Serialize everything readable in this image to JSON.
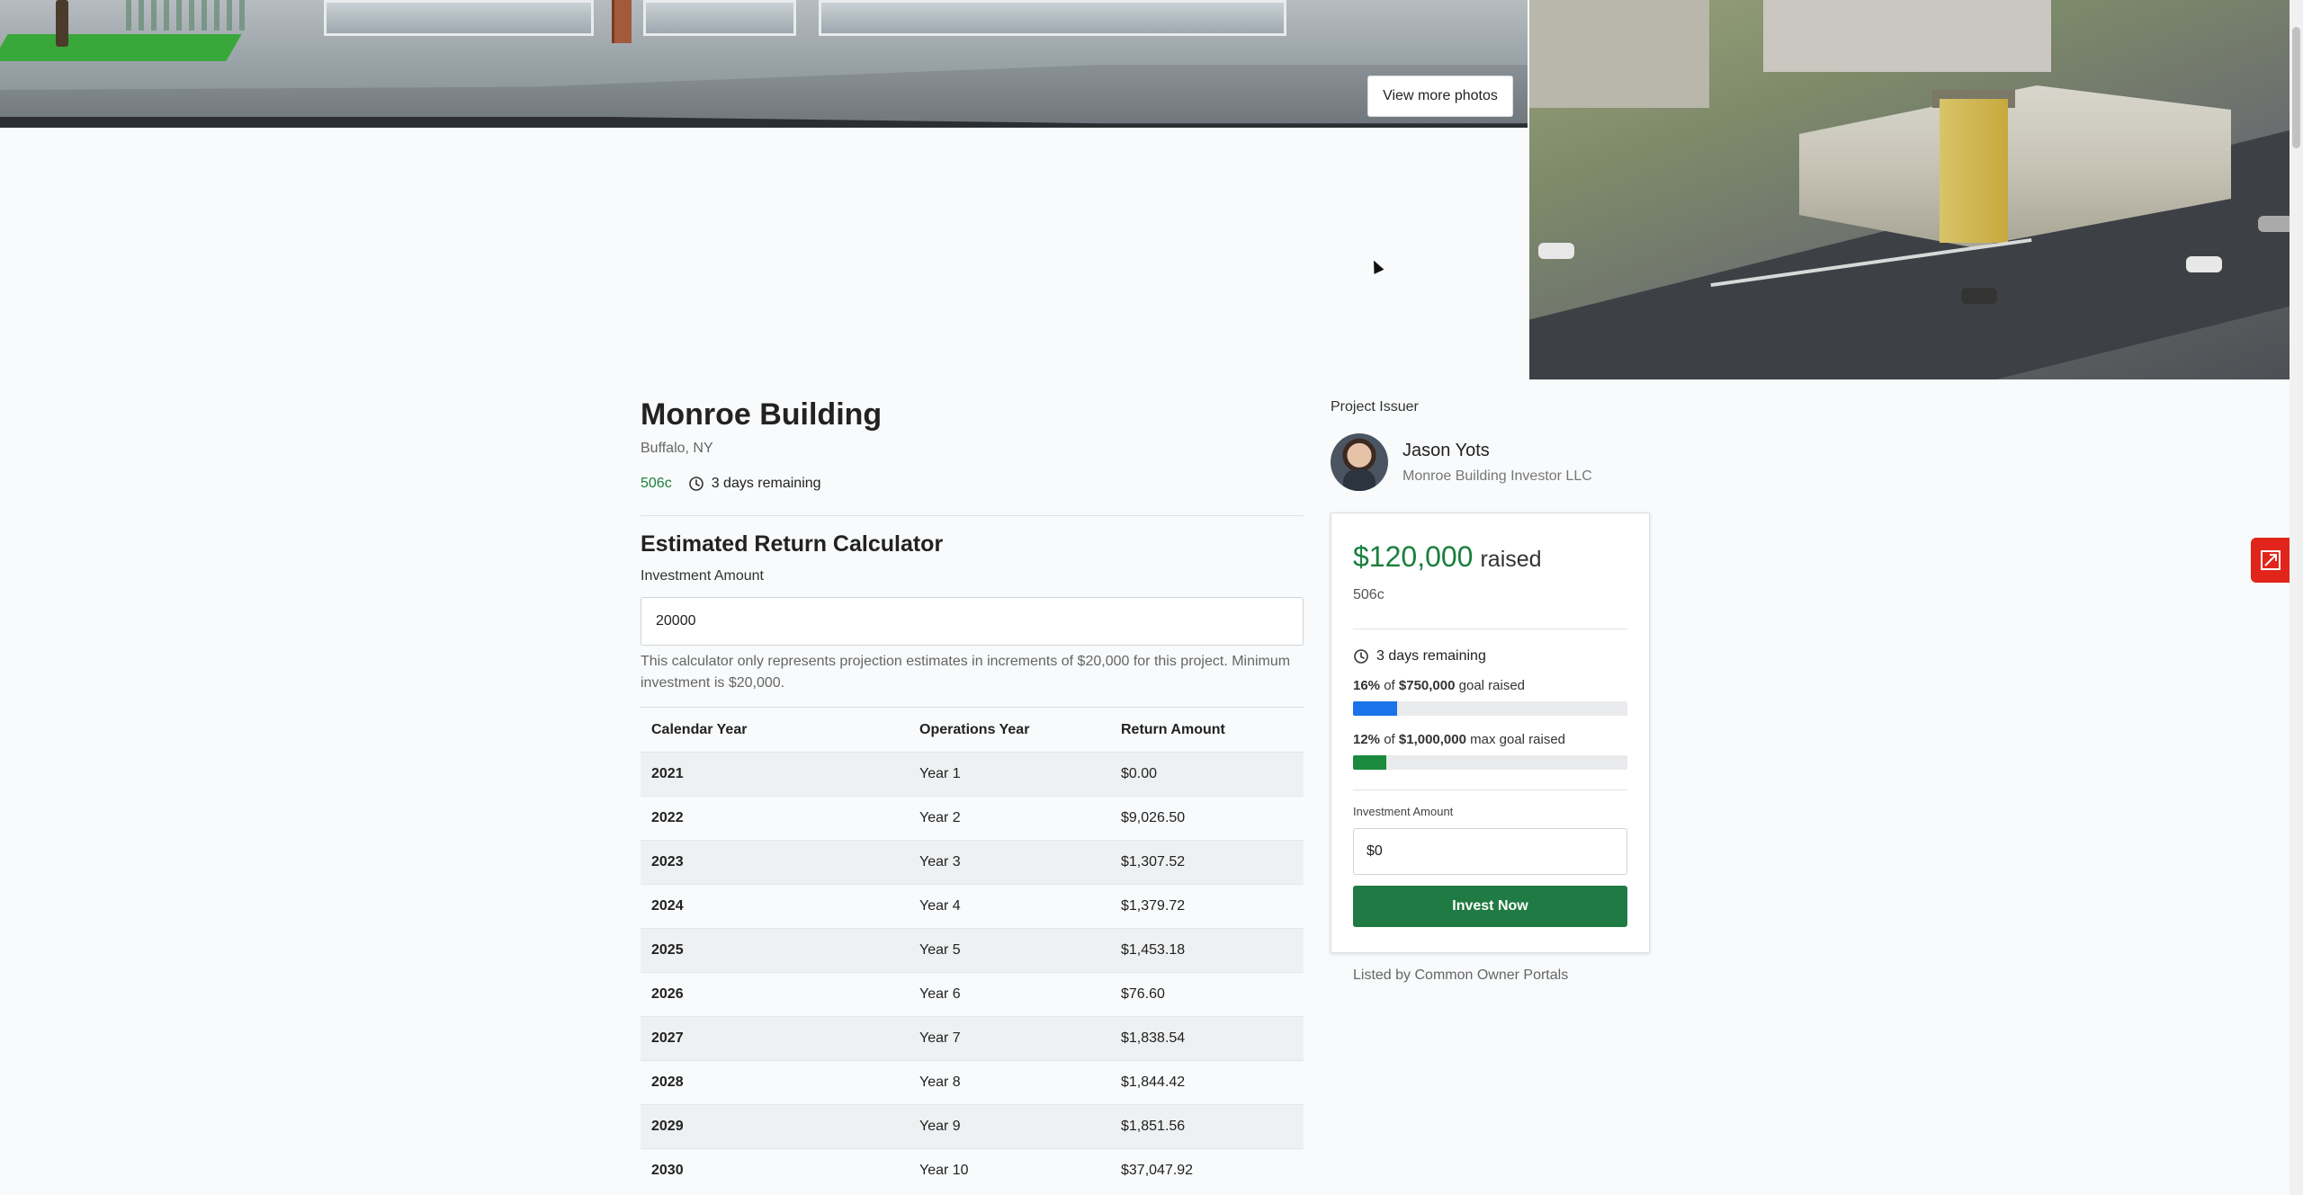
{
  "hero": {
    "view_photos_label": "View more photos"
  },
  "project": {
    "title": "Monroe Building",
    "location": "Buffalo, NY",
    "offering_type": "506c",
    "time_remaining": "3 days remaining"
  },
  "calculator": {
    "title": "Estimated Return Calculator",
    "amount_label": "Investment Amount",
    "amount_value": "20000",
    "note": "This calculator only represents projection estimates in increments of $20,000 for this project. Minimum investment is $20,000.",
    "columns": [
      "Calendar Year",
      "Operations Year",
      "Return Amount"
    ],
    "rows": [
      {
        "calendar_year": "2021",
        "operations_year": "Year 1",
        "return_amount": "$0.00"
      },
      {
        "calendar_year": "2022",
        "operations_year": "Year 2",
        "return_amount": "$9,026.50"
      },
      {
        "calendar_year": "2023",
        "operations_year": "Year 3",
        "return_amount": "$1,307.52"
      },
      {
        "calendar_year": "2024",
        "operations_year": "Year 4",
        "return_amount": "$1,379.72"
      },
      {
        "calendar_year": "2025",
        "operations_year": "Year 5",
        "return_amount": "$1,453.18"
      },
      {
        "calendar_year": "2026",
        "operations_year": "Year 6",
        "return_amount": "$76.60"
      },
      {
        "calendar_year": "2027",
        "operations_year": "Year 7",
        "return_amount": "$1,838.54"
      },
      {
        "calendar_year": "2028",
        "operations_year": "Year 8",
        "return_amount": "$1,844.42"
      },
      {
        "calendar_year": "2029",
        "operations_year": "Year 9",
        "return_amount": "$1,851.56"
      },
      {
        "calendar_year": "2030",
        "operations_year": "Year 10",
        "return_amount": "$37,047.92"
      }
    ]
  },
  "issuer": {
    "label": "Project Issuer",
    "name": "Jason Yots",
    "company": "Monroe Building Investor LLC"
  },
  "raise_card": {
    "raised_amount": "$120,000",
    "raised_word": "raised",
    "offering_type": "506c",
    "time_remaining": "3 days remaining",
    "goal": {
      "percent_text": "16%",
      "of_text": "of",
      "amount_text": "$750,000",
      "suffix": "goal raised",
      "progress": 0.16
    },
    "max_goal": {
      "percent_text": "12%",
      "of_text": "of",
      "amount_text": "$1,000,000",
      "suffix": "max goal raised",
      "progress": 0.12
    },
    "amount_label": "Investment Amount",
    "amount_value": "$0",
    "invest_label": "Invest Now",
    "accent_color": "#1a7f3c",
    "goal_bar_color": "#1a73e8",
    "max_bar_color": "#1a8a3c"
  },
  "listed_by": "Listed by Common Owner Portals",
  "icons": {
    "clock": "clock-icon",
    "side_widget": "external-share-icon"
  }
}
